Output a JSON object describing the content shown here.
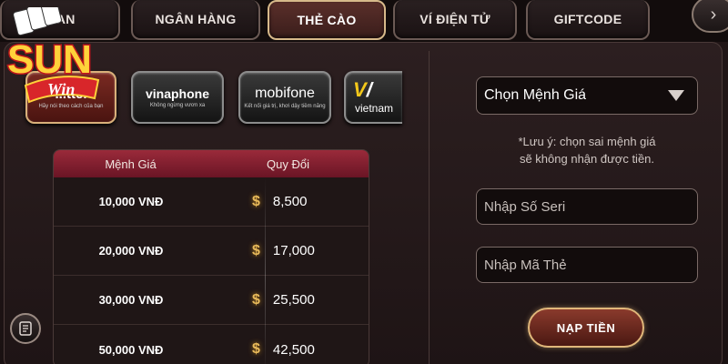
{
  "tabs": [
    {
      "label": "...AN",
      "active": false
    },
    {
      "label": "NGÂN HÀNG",
      "active": false
    },
    {
      "label": "THẺ CÀO",
      "active": true
    },
    {
      "label": "VÍ ĐIỆN TỬ",
      "active": false
    },
    {
      "label": "GIFTCODE",
      "active": false
    }
  ],
  "logo": {
    "text": "SUN",
    "sub": "Win"
  },
  "providers": [
    {
      "name": "...ttel",
      "sub": "Hãy nói theo cách của bạn",
      "selected": true
    },
    {
      "name": "vinaphone",
      "sub": "Không ngừng vươn xa"
    },
    {
      "name": "mobifone",
      "sub": "Kết nối giá trị, khơi dậy tiềm năng"
    },
    {
      "name": "vietnam",
      "sub": ""
    }
  ],
  "rate_table": {
    "headers": [
      "Mệnh Giá",
      "Quy Đổi"
    ],
    "rows": [
      {
        "face": "10,000 VNĐ",
        "value": "8,500"
      },
      {
        "face": "20,000 VNĐ",
        "value": "17,000"
      },
      {
        "face": "30,000 VNĐ",
        "value": "25,500"
      },
      {
        "face": "50,000 VNĐ",
        "value": "42,500"
      }
    ],
    "currency_symbol": "$"
  },
  "form": {
    "denomination_select": "Chọn Mệnh Giá",
    "note_line1": "*Lưu ý: chọn sai mệnh giá",
    "note_line2": "sẽ không nhận được tiền.",
    "serial_placeholder": "Nhập Số Seri",
    "code_placeholder": "Nhập Mã Thẻ",
    "submit_label": "NẠP TIỀN"
  },
  "colors": {
    "accent_gold": "#e0b77a",
    "header_red": "#9a2a3a",
    "logo_red": "#d8262a",
    "logo_yellow": "#ffd23a"
  }
}
